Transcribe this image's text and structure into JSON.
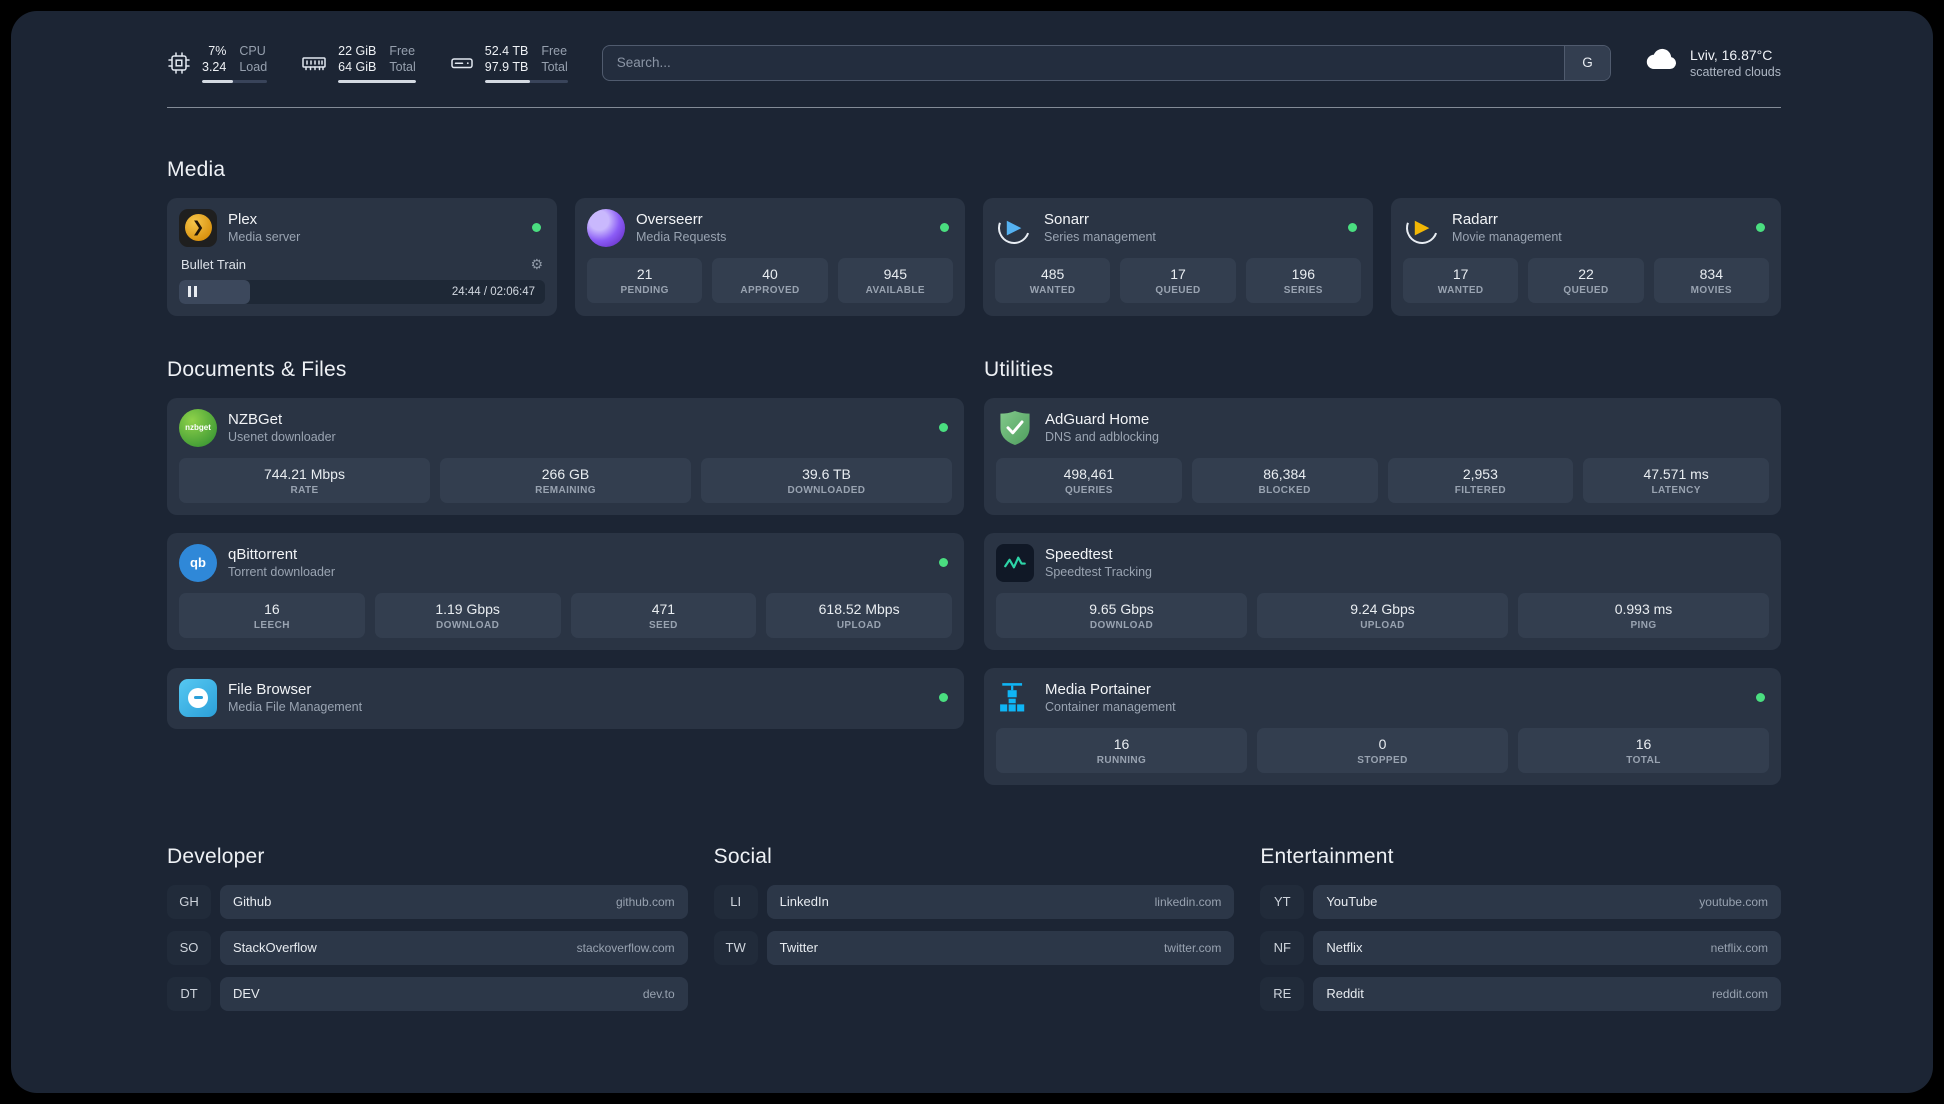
{
  "topbar": {
    "cpu": {
      "value1": "7%",
      "label1": "CPU",
      "value2": "3.24",
      "label2": "Load",
      "bar_pct": 48
    },
    "memory": {
      "value1": "22 GiB",
      "label1": "Free",
      "value2": "64 GiB",
      "label2": "Total",
      "bar_pct": 100
    },
    "disk": {
      "value1": "52.4 TB",
      "label1": "Free",
      "value2": "97.9 TB",
      "label2": "Total",
      "bar_pct": 54
    },
    "search": {
      "placeholder": "Search...",
      "button_label": "G"
    },
    "weather": {
      "location": "Lviv, 16.87°C",
      "condition": "scattered clouds"
    }
  },
  "sections": {
    "media": {
      "title": "Media"
    },
    "documents": {
      "title": "Documents & Files"
    },
    "utilities": {
      "title": "Utilities"
    }
  },
  "services": {
    "plex": {
      "name": "Plex",
      "subtitle": "Media server",
      "player": {
        "title": "Bullet Train",
        "time": "24:44 / 02:06:47",
        "progress_pct": 19.5
      }
    },
    "overseerr": {
      "name": "Overseerr",
      "subtitle": "Media Requests",
      "stats": [
        {
          "v": "21",
          "l": "PENDING"
        },
        {
          "v": "40",
          "l": "APPROVED"
        },
        {
          "v": "945",
          "l": "AVAILABLE"
        }
      ]
    },
    "sonarr": {
      "name": "Sonarr",
      "subtitle": "Series management",
      "stats": [
        {
          "v": "485",
          "l": "WANTED"
        },
        {
          "v": "17",
          "l": "QUEUED"
        },
        {
          "v": "196",
          "l": "SERIES"
        }
      ]
    },
    "radarr": {
      "name": "Radarr",
      "subtitle": "Movie management",
      "stats": [
        {
          "v": "17",
          "l": "WANTED"
        },
        {
          "v": "22",
          "l": "QUEUED"
        },
        {
          "v": "834",
          "l": "MOVIES"
        }
      ]
    },
    "nzbget": {
      "name": "NZBGet",
      "subtitle": "Usenet downloader",
      "stats": [
        {
          "v": "744.21 Mbps",
          "l": "RATE"
        },
        {
          "v": "266 GB",
          "l": "REMAINING"
        },
        {
          "v": "39.6 TB",
          "l": "DOWNLOADED"
        }
      ]
    },
    "qbittorrent": {
      "name": "qBittorrent",
      "subtitle": "Torrent downloader",
      "stats": [
        {
          "v": "16",
          "l": "LEECH"
        },
        {
          "v": "1.19 Gbps",
          "l": "DOWNLOAD"
        },
        {
          "v": "471",
          "l": "SEED"
        },
        {
          "v": "618.52 Mbps",
          "l": "UPLOAD"
        }
      ]
    },
    "filebrowser": {
      "name": "File Browser",
      "subtitle": "Media File Management"
    },
    "adguard": {
      "name": "AdGuard Home",
      "subtitle": "DNS and adblocking",
      "stats": [
        {
          "v": "498,461",
          "l": "QUERIES"
        },
        {
          "v": "86,384",
          "l": "BLOCKED"
        },
        {
          "v": "2,953",
          "l": "FILTERED"
        },
        {
          "v": "47.571 ms",
          "l": "LATENCY"
        }
      ]
    },
    "speedtest": {
      "name": "Speedtest",
      "subtitle": "Speedtest Tracking",
      "stats": [
        {
          "v": "9.65 Gbps",
          "l": "DOWNLOAD"
        },
        {
          "v": "9.24 Gbps",
          "l": "UPLOAD"
        },
        {
          "v": "0.993 ms",
          "l": "PING"
        }
      ]
    },
    "portainer": {
      "name": "Media Portainer",
      "subtitle": "Container management",
      "stats": [
        {
          "v": "16",
          "l": "RUNNING"
        },
        {
          "v": "0",
          "l": "STOPPED"
        },
        {
          "v": "16",
          "l": "TOTAL"
        }
      ]
    }
  },
  "bookmarks": {
    "developer": {
      "title": "Developer",
      "items": [
        {
          "abbr": "GH",
          "name": "Github",
          "url": "github.com"
        },
        {
          "abbr": "SO",
          "name": "StackOverflow",
          "url": "stackoverflow.com"
        },
        {
          "abbr": "DT",
          "name": "DEV",
          "url": "dev.to"
        }
      ]
    },
    "social": {
      "title": "Social",
      "items": [
        {
          "abbr": "LI",
          "name": "LinkedIn",
          "url": "linkedin.com"
        },
        {
          "abbr": "TW",
          "name": "Twitter",
          "url": "twitter.com"
        }
      ]
    },
    "entertainment": {
      "title": "Entertainment",
      "items": [
        {
          "abbr": "YT",
          "name": "YouTube",
          "url": "youtube.com"
        },
        {
          "abbr": "NF",
          "name": "Netflix",
          "url": "netflix.com"
        },
        {
          "abbr": "RE",
          "name": "Reddit",
          "url": "reddit.com"
        }
      ]
    }
  },
  "icons": {
    "gear": "⚙",
    "plex_chevron": "❯",
    "play": "▶",
    "nzbget_label": "nzbget",
    "qb_label": "qb"
  },
  "colors": {
    "status_online": "#4ade80",
    "plex_amber": "#e5a00d",
    "sonarr_blue": "#55b2f2",
    "radarr_amber": "#f2b705",
    "adguard_green": "#67b279",
    "portainer_blue": "#0fb5f5",
    "speedtest_green": "#2dd4a7",
    "background": "#1c2534",
    "card": "#2a3444"
  }
}
